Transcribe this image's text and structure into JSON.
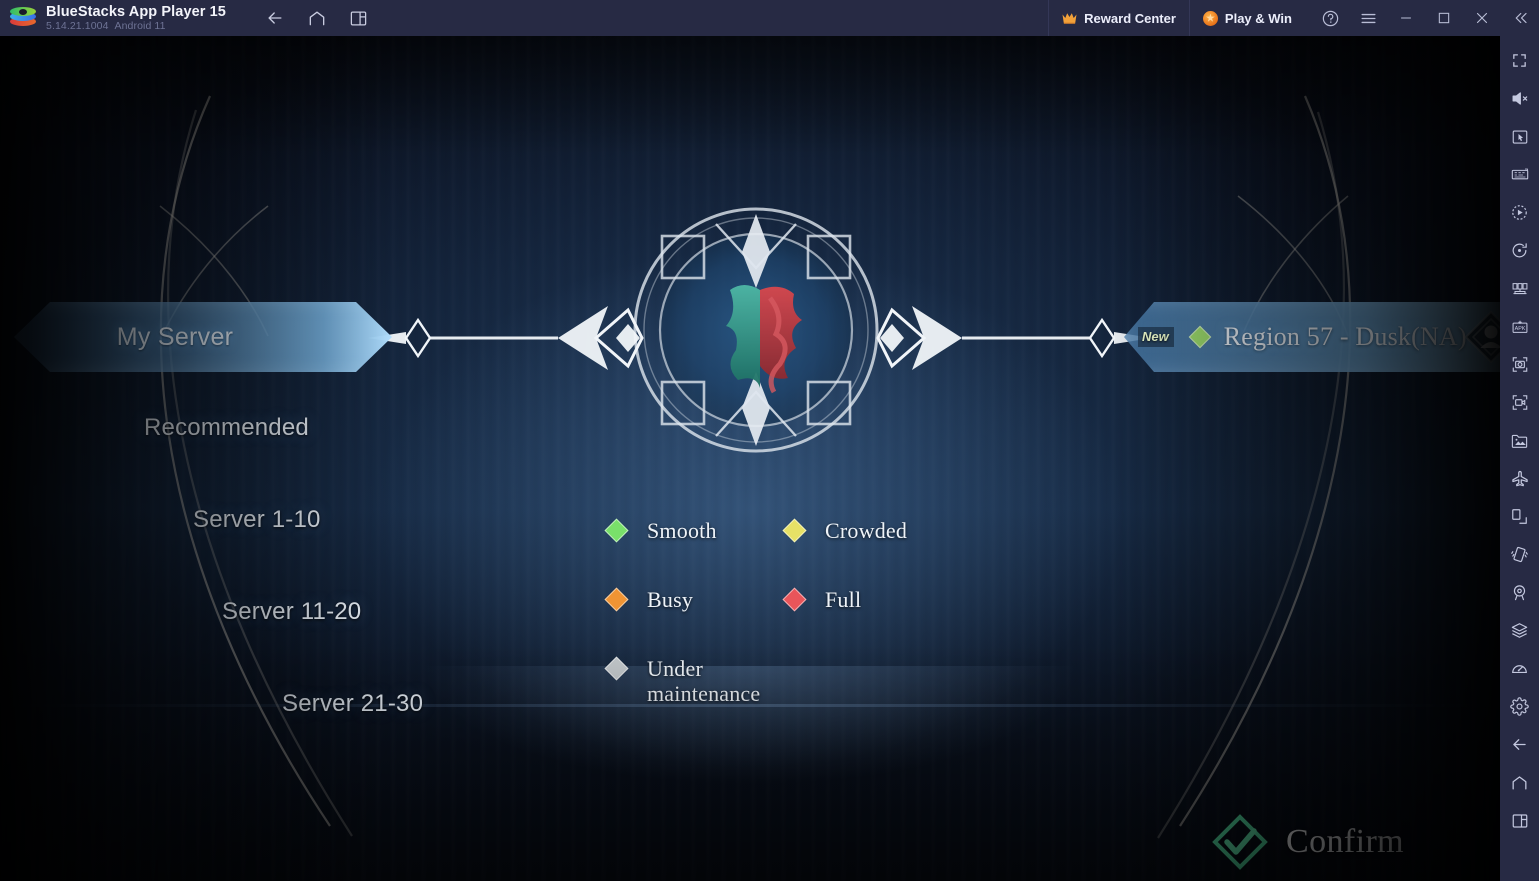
{
  "titlebar": {
    "app_name": "BlueStacks App Player 15",
    "version": "5.14.21.1004",
    "android": "Android 11",
    "nav": [
      {
        "name": "back-icon",
        "label": "Back"
      },
      {
        "name": "home-icon",
        "label": "Home"
      },
      {
        "name": "multi-instance-icon",
        "label": "Multi-instance"
      }
    ],
    "reward_center": "Reward Center",
    "play_and_win": "Play & Win",
    "help": "?",
    "menu": "Menu",
    "minimize": "Minimize",
    "maximize": "Maximize",
    "close": "Close",
    "collapse": "Collapse sidebar",
    "bg_color": "#272a44"
  },
  "game": {
    "left_panel": {
      "selected_tab": "My Server",
      "items": [
        {
          "label": "Recommended"
        },
        {
          "label": "Server 1-10"
        },
        {
          "label": "Server 11-20"
        },
        {
          "label": "Server 21-30"
        }
      ]
    },
    "right_panel": {
      "badge": "New",
      "status_color": "#9ede6e",
      "region_name": "Region 57 - Dusk(NA)"
    },
    "legend": {
      "rows": [
        [
          {
            "label": "Smooth",
            "color": "#79e06a"
          },
          {
            "label": "Crowded",
            "color": "#e7e166"
          }
        ],
        [
          {
            "label": "Busy",
            "color": "#f09434"
          },
          {
            "label": "Full",
            "color": "#e9555a"
          }
        ],
        [
          {
            "label": "Under\nmaintenance",
            "color": "#c3c8cb"
          }
        ]
      ]
    },
    "confirm": {
      "label": "Confirm",
      "accent_color": "#4fd29a"
    }
  },
  "sidebar": {
    "items": [
      {
        "name": "fullscreen-icon",
        "label": "Fullscreen"
      },
      {
        "name": "mute-icon",
        "label": "Mute"
      },
      {
        "name": "cursor-control-icon",
        "label": "Cursor control"
      },
      {
        "name": "keyboard-controls-icon",
        "label": "Game controls"
      },
      {
        "name": "macro-play-icon",
        "label": "Macro recorder"
      },
      {
        "name": "sync-operations-icon",
        "label": "Sync operations"
      },
      {
        "name": "multi-instance-sync-icon",
        "label": "Instance manager"
      },
      {
        "name": "install-apk-icon",
        "label": "Install APK"
      },
      {
        "name": "screenshot-icon",
        "label": "Screenshot"
      },
      {
        "name": "record-screen-icon",
        "label": "Record screen"
      },
      {
        "name": "media-manager-icon",
        "label": "Media manager"
      },
      {
        "name": "airplane-mode-icon",
        "label": "Airplane mode"
      },
      {
        "name": "rotate-screen-icon",
        "label": "Rotate"
      },
      {
        "name": "shake-icon",
        "label": "Shake"
      },
      {
        "name": "location-icon",
        "label": "Location"
      },
      {
        "name": "eco-mode-icon",
        "label": "Eco mode"
      },
      {
        "name": "performance-icon",
        "label": "Performance"
      },
      {
        "name": "settings-icon",
        "label": "Settings"
      },
      {
        "name": "back-icon",
        "label": "Back"
      },
      {
        "name": "home-icon",
        "label": "Home"
      },
      {
        "name": "recents-icon",
        "label": "Recents"
      }
    ]
  }
}
